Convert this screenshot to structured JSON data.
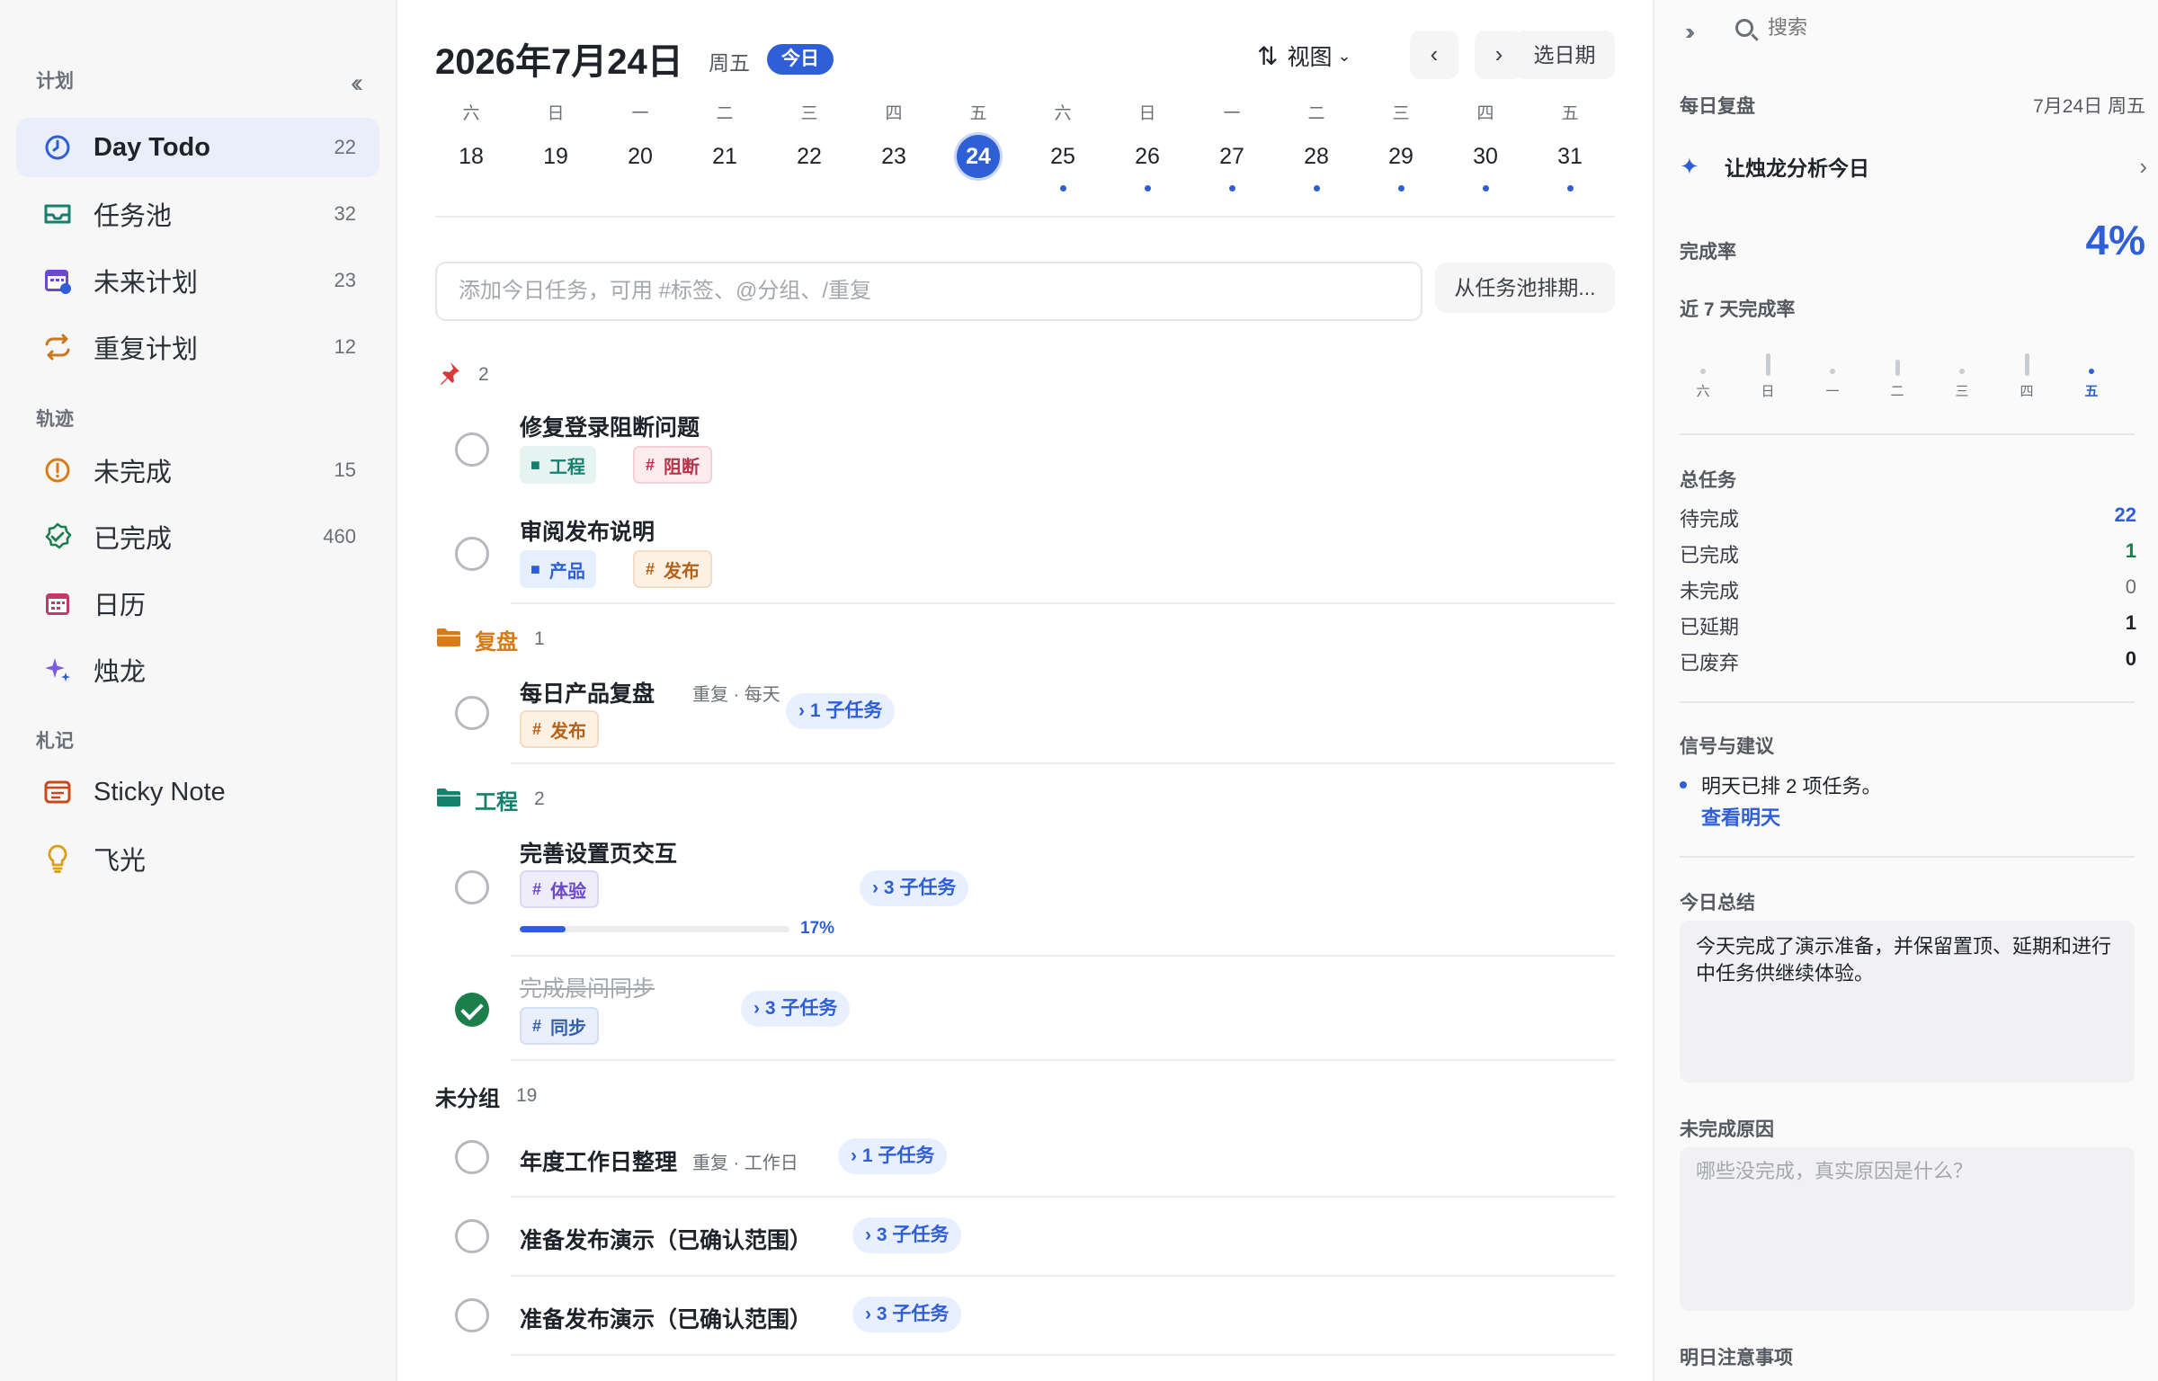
{
  "sidebar": {
    "sections": {
      "plan": "计划",
      "track": "轨迹",
      "notes": "札记"
    },
    "items": [
      {
        "label": "Day Todo",
        "count": "22"
      },
      {
        "label": "任务池",
        "count": "32"
      },
      {
        "label": "未来计划",
        "count": "23"
      },
      {
        "label": "重复计划",
        "count": "12"
      },
      {
        "label": "未完成",
        "count": "15"
      },
      {
        "label": "已完成",
        "count": "460"
      },
      {
        "label": "日历",
        "count": ""
      },
      {
        "label": "烛龙",
        "count": ""
      },
      {
        "label": "Sticky Note",
        "count": ""
      },
      {
        "label": "飞光",
        "count": ""
      }
    ]
  },
  "header": {
    "date": "2026年7月24日",
    "weekday": "周五",
    "today": "今日",
    "view": "视图",
    "pick_date": "选日期"
  },
  "strip": [
    {
      "wd": "六",
      "d": "18"
    },
    {
      "wd": "日",
      "d": "19"
    },
    {
      "wd": "一",
      "d": "20"
    },
    {
      "wd": "二",
      "d": "21"
    },
    {
      "wd": "三",
      "d": "22"
    },
    {
      "wd": "四",
      "d": "23"
    },
    {
      "wd": "五",
      "d": "24"
    },
    {
      "wd": "六",
      "d": "25"
    },
    {
      "wd": "日",
      "d": "26"
    },
    {
      "wd": "一",
      "d": "27"
    },
    {
      "wd": "二",
      "d": "28"
    },
    {
      "wd": "三",
      "d": "29"
    },
    {
      "wd": "四",
      "d": "30"
    },
    {
      "wd": "五",
      "d": "31"
    }
  ],
  "add": {
    "placeholder": "添加今日任务，可用 #标签、@分组、/重复",
    "schedule": "从任务池排期..."
  },
  "groups": {
    "pinned_count": "2",
    "review": {
      "name": "复盘",
      "count": "1"
    },
    "eng": {
      "name": "工程",
      "count": "2"
    },
    "ungrouped": {
      "name": "未分组",
      "count": "19"
    }
  },
  "tasks": {
    "t1": {
      "title": "修复登录阻断问题",
      "tag1": "工程",
      "tag2": "阻断"
    },
    "t2": {
      "title": "审阅发布说明",
      "tag1": "产品",
      "tag2": "发布"
    },
    "t3": {
      "title": "每日产品复盘",
      "repeat": "重复 · 每天",
      "tag1": "发布",
      "sub": "1 子任务"
    },
    "t4": {
      "title": "完善设置页交互",
      "tag1": "体验",
      "sub": "3 子任务",
      "pct": "17%",
      "progress": 0.17
    },
    "t5": {
      "title": "完成晨间同步",
      "tag1": "同步",
      "sub": "3 子任务"
    },
    "t6": {
      "title": "年度工作日整理",
      "repeat": "重复 · 工作日",
      "sub": "1 子任务"
    },
    "t7": {
      "title": "准备发布演示（已确认范围）",
      "sub": "3 子任务"
    },
    "t8": {
      "title": "准备发布演示（已确认范围）",
      "sub": "3 子任务"
    }
  },
  "panel": {
    "search_placeholder": "搜索",
    "daily_review": "每日复盘",
    "review_date": "7月24日 周五",
    "ai": "让烛龙分析今日",
    "rate_label": "完成率",
    "rate_value": "4%",
    "week_label": "近 7 天完成率",
    "week": [
      {
        "wd": "六",
        "rate": 0
      },
      {
        "wd": "日",
        "rate": 0.35
      },
      {
        "wd": "一",
        "rate": 0
      },
      {
        "wd": "二",
        "rate": 0.25
      },
      {
        "wd": "三",
        "rate": 0
      },
      {
        "wd": "四",
        "rate": 0.35
      },
      {
        "wd": "五",
        "rate": 0.04
      }
    ],
    "total_label": "总任务",
    "stats": [
      {
        "label": "待完成",
        "value": "22"
      },
      {
        "label": "已完成",
        "value": "1"
      },
      {
        "label": "未完成",
        "value": "0"
      },
      {
        "label": "已延期",
        "value": "1"
      },
      {
        "label": "已废弃",
        "value": "0"
      }
    ],
    "signals_label": "信号与建议",
    "signal": "明天已排 2 项任务。",
    "signal_link": "查看明天",
    "summary_label": "今日总结",
    "summary": "今天完成了演示准备，并保留置顶、延期和进行中任务供继续体验。",
    "reason_label": "未完成原因",
    "reason_placeholder": "哪些没完成，真实原因是什么？",
    "tomorrow_label": "明日注意事项"
  },
  "colors": {
    "accent": "#2f5fd6",
    "success": "#1a7f4b",
    "review": "#d97a14",
    "eng": "#16806e"
  }
}
